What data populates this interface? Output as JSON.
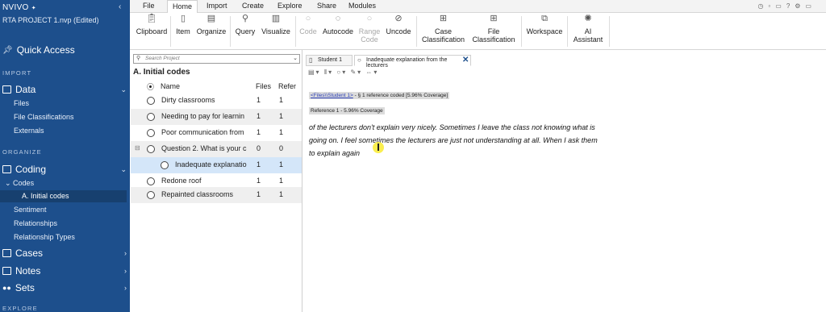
{
  "app": {
    "brand": "NVIVO",
    "project_title": "RTA PROJECT 1.nvp (Edited)",
    "collapse_label": "‹"
  },
  "sidebar": {
    "quick_access": "Quick Access",
    "sections": {
      "import": "IMPORT",
      "organize": "ORGANIZE",
      "explore": "EXPLORE"
    },
    "data": {
      "label": "Data",
      "items": [
        "Files",
        "File Classifications",
        "Externals"
      ]
    },
    "coding": {
      "label": "Coding",
      "codes_label": "Codes",
      "selected": "A. Initial codes",
      "items": [
        "Sentiment",
        "Relationships",
        "Relationship Types"
      ]
    },
    "cases": "Cases",
    "notes": "Notes",
    "sets": "Sets"
  },
  "ribbon": {
    "tabs": [
      "File",
      "Home",
      "Import",
      "Create",
      "Explore",
      "Share",
      "Modules"
    ],
    "active_tab": "Home",
    "buttons": [
      {
        "label": "Clipboard",
        "icon": "clipboard-icon"
      },
      {
        "label": "Item",
        "icon": "item-icon"
      },
      {
        "label": "Organize",
        "icon": "organize-icon"
      },
      {
        "label": "Query",
        "icon": "query-icon"
      },
      {
        "label": "Visualize",
        "icon": "visualize-icon"
      },
      {
        "label": "Code",
        "icon": "code-icon",
        "disabled": true
      },
      {
        "label": "Autocode",
        "icon": "autocode-icon"
      },
      {
        "label": "Range\nCode",
        "icon": "range-code-icon",
        "disabled": true
      },
      {
        "label": "Uncode",
        "icon": "uncode-icon"
      },
      {
        "label": "Case\nClassification",
        "icon": "case-classification-icon"
      },
      {
        "label": "File\nClassification",
        "icon": "file-classification-icon"
      },
      {
        "label": "Workspace",
        "icon": "workspace-icon"
      },
      {
        "label": "AI\nAssistant",
        "icon": "ai-assistant-icon"
      }
    ]
  },
  "list": {
    "search_placeholder": "Search Project",
    "title": "A. Initial codes",
    "columns": {
      "name": "Name",
      "files": "Files",
      "refs": "Refer"
    },
    "rows": [
      {
        "name": "Dirty classrooms",
        "files": "1",
        "refs": "1"
      },
      {
        "name": "Needing to pay for learnin",
        "files": "1",
        "refs": "1"
      },
      {
        "name": "Poor communication from",
        "files": "1",
        "refs": "1"
      },
      {
        "name": "Question 2. What is your c",
        "files": "0",
        "refs": "0"
      },
      {
        "name": "Inadequate explanatio",
        "files": "1",
        "refs": "1"
      },
      {
        "name": "Redone roof",
        "files": "1",
        "refs": "1"
      },
      {
        "name": "Repainted classrooms",
        "files": "1",
        "refs": "1"
      }
    ]
  },
  "document": {
    "tabs": [
      "Student 1",
      "Inadequate explanation from the lecturers"
    ],
    "ref_link": "<Files\\\\Student 1>",
    "ref_summary": " - § 1 reference coded  [5.96% Coverage]",
    "ref_label": "Reference 1 - 5.96% Coverage",
    "text": "of the lecturers don't explain very nicely. Sometimes I leave the class not knowing what is going on. I feel sometimes the lecturers are just not understanding at all. When I ask them to explain again"
  },
  "colors": {
    "sidebar": "#1d4f8c",
    "selected_row": "#d4e6f9",
    "link": "#2b3fb8",
    "cursor_highlight": "#faec3c"
  }
}
